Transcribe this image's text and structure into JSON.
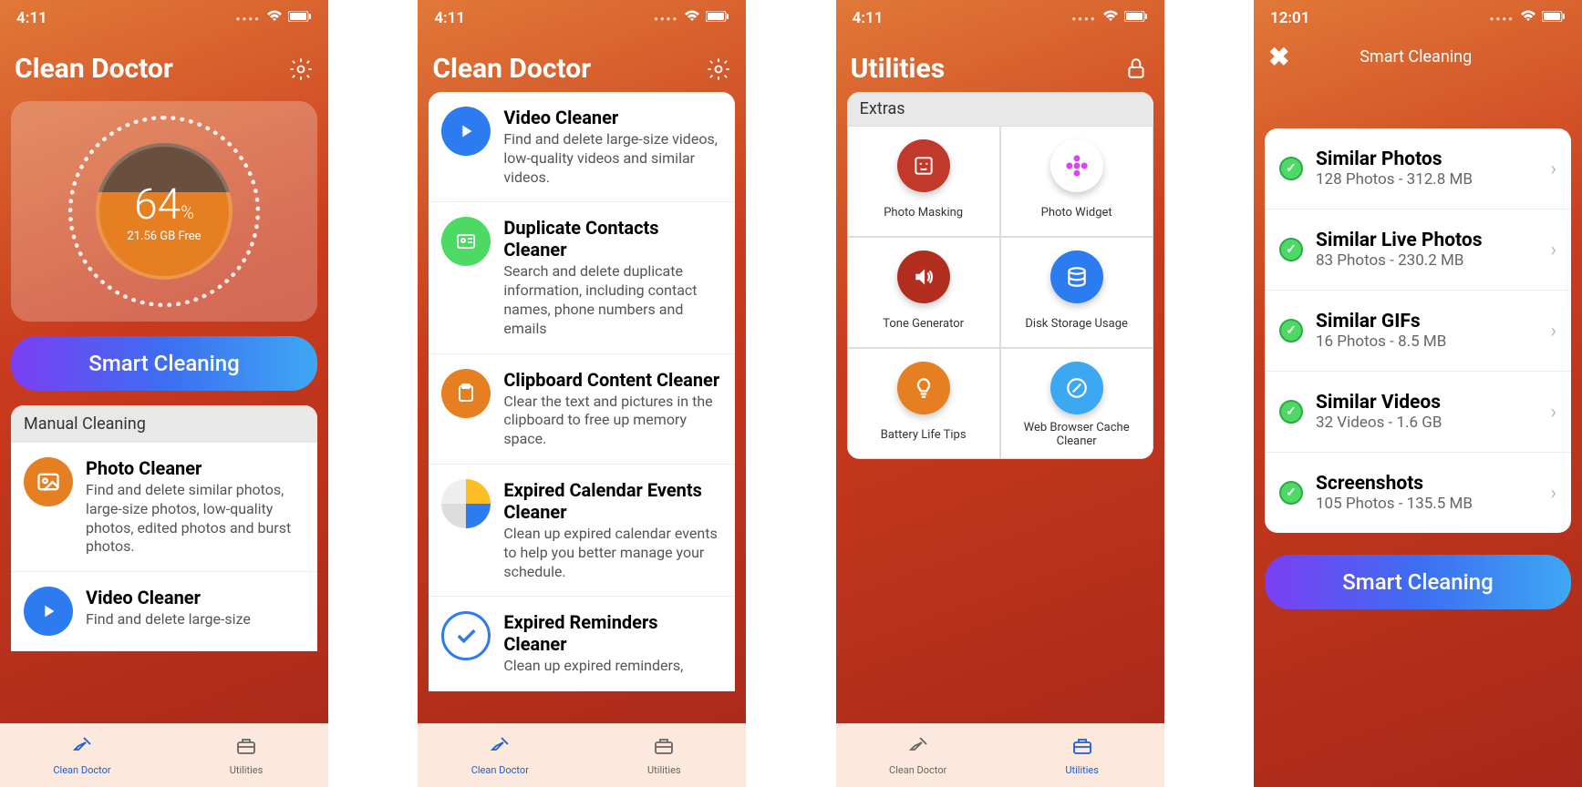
{
  "status": {
    "time1": "4:11",
    "time4": "12:01"
  },
  "app_title": "Clean Doctor",
  "utilities_title": "Utilities",
  "gauge": {
    "percent": "64",
    "percent_sym": "%",
    "free": "21.56 GB Free"
  },
  "smart_cleaning_label": "Smart Cleaning",
  "manual_cleaning_label": "Manual Cleaning",
  "screen1_items": [
    {
      "title": "Photo Cleaner",
      "desc": "Find and delete similar photos, large-size photos, low-quality photos, edited photos and burst photos.",
      "icon": "photo",
      "color": "#e67e22"
    },
    {
      "title": "Video Cleaner",
      "desc": "Find and delete large-size",
      "icon": "play",
      "color": "#2d7bf0"
    }
  ],
  "screen2_items": [
    {
      "title": "Video Cleaner",
      "desc": "Find and delete large-size videos, low-quality videos and similar videos.",
      "icon": "play",
      "color": "#2d7bf0"
    },
    {
      "title": "Duplicate Contacts Cleaner",
      "desc": "Search and delete duplicate information, including contact names, phone numbers and emails",
      "icon": "card",
      "color": "#4cd964"
    },
    {
      "title": "Clipboard Content Cleaner",
      "desc": "Clear the text and pictures in the clipboard to free up memory space.",
      "icon": "clipboard",
      "color": "#e67e22"
    },
    {
      "title": "Expired Calendar Events Cleaner",
      "desc": "Clean up expired calendar events to help you better manage your schedule.",
      "icon": "calendar",
      "color": "multi"
    },
    {
      "title": "Expired Reminders Cleaner",
      "desc": "Clean up expired reminders,",
      "icon": "check",
      "color": "#2d7bf0"
    }
  ],
  "extras_label": "Extras",
  "utilities": [
    {
      "label": "Photo Masking",
      "icon": "mask",
      "color": "#c0392b"
    },
    {
      "label": "Photo Widget",
      "icon": "flower",
      "color": "#fff"
    },
    {
      "label": "Tone Generator",
      "icon": "sound",
      "color": "#b12d1e"
    },
    {
      "label": "Disk Storage Usage",
      "icon": "disk",
      "color": "#2d7bf0"
    },
    {
      "label": "Battery Life Tips",
      "icon": "bulb",
      "color": "#e67e22"
    },
    {
      "label": "Web Browser Cache Cleaner",
      "icon": "safari",
      "color": "#3da8f2"
    }
  ],
  "smart_cleaning_results_title": "Smart Cleaning",
  "results": [
    {
      "title": "Similar Photos",
      "sub": "128 Photos - 312.8 MB"
    },
    {
      "title": "Similar Live Photos",
      "sub": "83 Photos - 230.2 MB"
    },
    {
      "title": "Similar GIFs",
      "sub": "16 Photos - 8.5 MB"
    },
    {
      "title": "Similar Videos",
      "sub": "32 Videos - 1.6 GB"
    },
    {
      "title": "Screenshots",
      "sub": "105 Photos - 135.5 MB"
    }
  ],
  "tabs": {
    "clean_doctor": "Clean Doctor",
    "utilities": "Utilities"
  }
}
